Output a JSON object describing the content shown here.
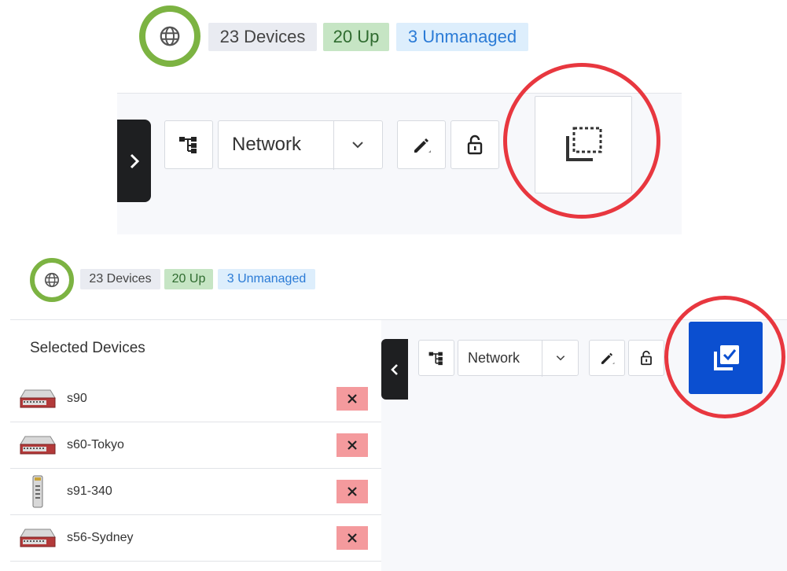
{
  "top": {
    "status": {
      "devices": "23 Devices",
      "up": "20 Up",
      "unmanaged": "3 Unmanaged"
    },
    "toolbar": {
      "dropdown_value": "Network"
    }
  },
  "bottom": {
    "status": {
      "devices": "23 Devices",
      "up": "20 Up",
      "unmanaged": "3 Unmanaged"
    },
    "selected_panel": {
      "title": "Selected Devices",
      "devices": [
        {
          "name": "s90",
          "icon": "router-icon"
        },
        {
          "name": "s60-Tokyo",
          "icon": "router-icon"
        },
        {
          "name": "s91-340",
          "icon": "access-point-icon"
        },
        {
          "name": "s56-Sydney",
          "icon": "router-icon"
        }
      ]
    },
    "toolbar": {
      "dropdown_value": "Network"
    }
  },
  "colors": {
    "highlight_ring": "#e8373f",
    "globe_ring": "#7cb342",
    "select_active": "#0b4fd0",
    "remove": "#f49a9d"
  }
}
